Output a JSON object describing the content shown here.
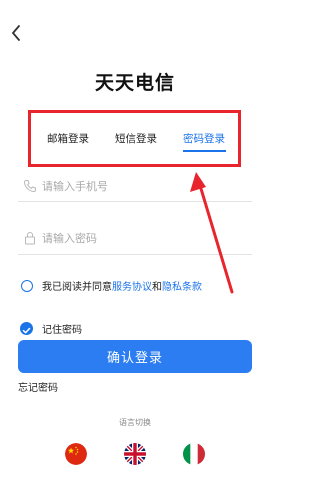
{
  "title": "天天电信",
  "tabs": [
    {
      "label": "邮箱登录",
      "active": false
    },
    {
      "label": "短信登录",
      "active": false
    },
    {
      "label": "密码登录",
      "active": true
    }
  ],
  "phone": {
    "placeholder": "请输入手机号",
    "icon": "phone-icon"
  },
  "password": {
    "placeholder": "请输入密码",
    "icon": "lock-icon"
  },
  "agreement": {
    "prefix": "我已阅读并同意",
    "service": "服务协议",
    "and": "和",
    "privacy": "隐私条款"
  },
  "remember_label": "记住密码",
  "confirm_label": "确认登录",
  "forgot_label": "忘记密码",
  "language_label": "语言切换",
  "languages": [
    "chinese-flag",
    "uk-flag",
    "italy-flag"
  ],
  "colors": {
    "accent": "#2b7df1",
    "annotation": "#e8242c"
  }
}
